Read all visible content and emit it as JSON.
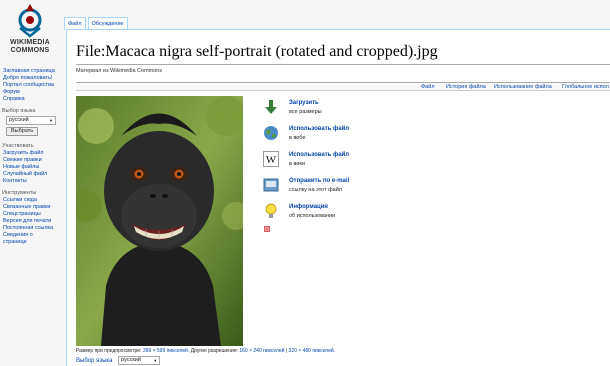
{
  "logo": {
    "line1": "WIKIMEDIA",
    "line2": "COMMONS"
  },
  "sidebar": {
    "nav": [
      "Заглавная страница",
      "Добро пожаловать!",
      "Портал сообщества",
      "Форум",
      "Справка"
    ],
    "lang_heading": "Выбор языка",
    "lang_value": "русский",
    "lang_button": "Выбрать",
    "participate_heading": "Участвовать",
    "participate": [
      "Загрузить файл",
      "Свежие правки",
      "Новые файлы",
      "Случайный файл",
      "Контакты"
    ],
    "tools_heading": "Инструменты",
    "tools": [
      "Ссылки сюда",
      "Связанные правки",
      "Спецстраницы",
      "Версия для печати",
      "Постоянная ссылка",
      "Сведения о",
      "странице"
    ]
  },
  "tabs": [
    "Файл",
    "Обсуждение"
  ],
  "page": {
    "title": "File:Macaca nigra self-portrait (rotated and cropped).jpg",
    "subtitle": "Материал из Wikimedia Commons"
  },
  "filetoc": [
    "Файл",
    "История файла",
    "Использование файла",
    "Глобальное испол"
  ],
  "actions": [
    {
      "title": "Загрузить",
      "desc": "все размеры",
      "icon": "download-icon"
    },
    {
      "title": "Использовать файл",
      "desc": "в вебе",
      "icon": "globe-icon"
    },
    {
      "title": "Использовать файл",
      "desc": "в вики",
      "icon": "wikipedia-icon"
    },
    {
      "title": "Отправить по e-mail",
      "desc": "ссылку на этот файл",
      "icon": "email-icon"
    },
    {
      "title": "Информация",
      "desc": "об использовании",
      "icon": "lightbulb-icon"
    }
  ],
  "preview": {
    "prefix": "Размер при предпросмотре: ",
    "size_link": "399 × 599 пикселей",
    "mid": ". Другие разрешения: ",
    "res1": "160 × 240 пикселей",
    "sep": " | ",
    "res2": "320 × 480 пикселей",
    "end": "."
  },
  "bottom": {
    "lang_label": "Выбор языка",
    "lang_value": "русский"
  },
  "colors": {
    "link": "#0645ad",
    "tab_border": "#a7d7f9",
    "logo_red": "#990000",
    "logo_blue": "#069"
  }
}
